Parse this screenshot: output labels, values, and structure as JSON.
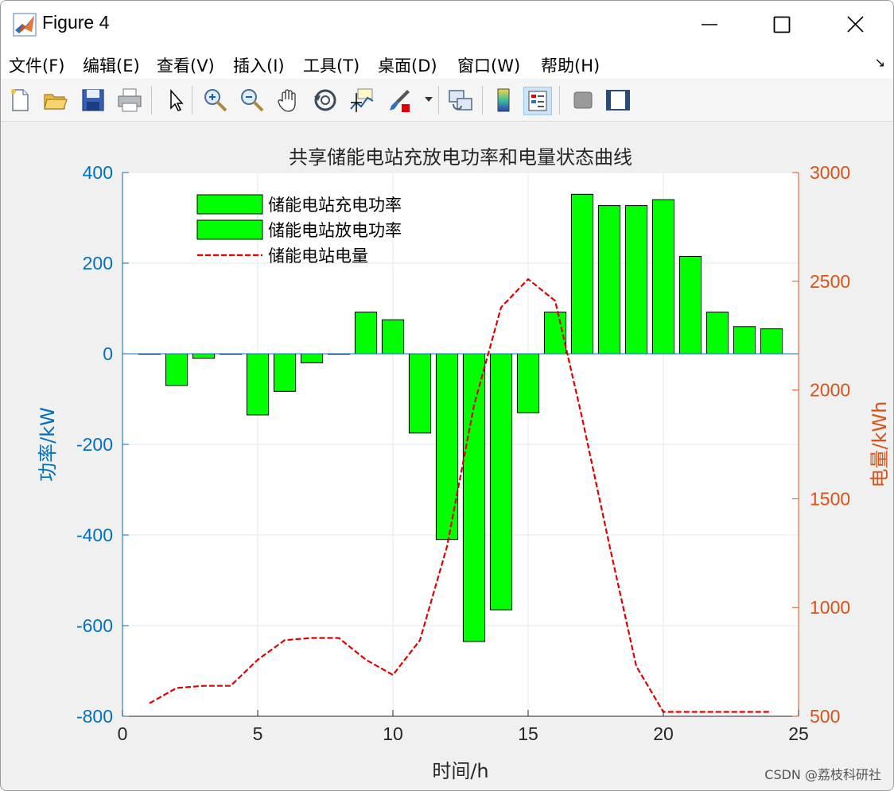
{
  "window": {
    "title": "Figure 4"
  },
  "menu": [
    "文件(F)",
    "编辑(E)",
    "查看(V)",
    "插入(I)",
    "工具(T)",
    "桌面(D)",
    "窗口(W)",
    "帮助(H)"
  ],
  "toolbar": {
    "icons": [
      "new-figure-icon",
      "open-file-icon",
      "save-icon",
      "print-icon",
      "select-arrow-icon",
      "zoom-in-icon",
      "zoom-out-icon",
      "pan-hand-icon",
      "rotate-3d-icon",
      "data-cursor-icon",
      "brush-icon",
      "link-plot-icon",
      "colorbar-icon",
      "legend-icon",
      "hide-plot-tools-icon",
      "show-plot-tools-icon"
    ]
  },
  "watermark": "CSDN @荔枝科研社",
  "chart_data": {
    "type": "bar",
    "title": "共享储能电站充放电功率和电量状态曲线",
    "xlabel": "时间/h",
    "ylabel_left": "功率/kW",
    "ylabel_right": "电量/kWh",
    "xlim": [
      0,
      25
    ],
    "ylim_left": [
      -800,
      400
    ],
    "ylim_right": [
      500,
      3000
    ],
    "xticks": [
      "0",
      "5",
      "10",
      "15",
      "20",
      "25"
    ],
    "yticks_left": [
      "400",
      "200",
      "0",
      "-200",
      "-400",
      "-600",
      "-800"
    ],
    "yticks_right": [
      "3000",
      "2500",
      "2000",
      "1500",
      "1000",
      "500"
    ],
    "grid": true,
    "legend_position": "top-left",
    "legend": [
      "储能电站充电功率",
      "储能电站放电功率",
      "储能电站电量"
    ],
    "colors": {
      "bar_fill": "#00ff00",
      "line": "#e00000",
      "left_axis": "#0072bd",
      "right_axis": "#d95319"
    },
    "x": [
      1,
      2,
      3,
      4,
      5,
      6,
      7,
      8,
      9,
      10,
      11,
      12,
      13,
      14,
      15,
      16,
      17,
      18,
      19,
      20,
      21,
      22,
      23,
      24
    ],
    "power": [
      0,
      -70,
      -10,
      0,
      -135,
      -83,
      -20,
      0,
      92,
      75,
      -175,
      -410,
      -635,
      -565,
      -130,
      92,
      352,
      327,
      327,
      340,
      215,
      92,
      60,
      55
    ],
    "energy": [
      560,
      630,
      640,
      640,
      760,
      850,
      860,
      860,
      760,
      690,
      850,
      1280,
      1930,
      2380,
      2510,
      2410,
      1870,
      1290,
      730,
      520,
      520,
      520,
      520,
      520
    ]
  }
}
